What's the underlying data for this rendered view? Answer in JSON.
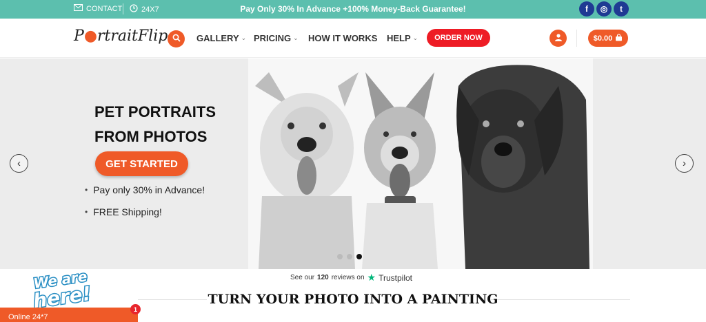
{
  "topbar": {
    "contact_label": "CONTACT",
    "hours_label": "24X7",
    "promo": "Pay Only 30% In Advance +100% Money-Back Guarantee!",
    "social": [
      {
        "icon": "facebook-icon",
        "glyph": "f"
      },
      {
        "icon": "instagram-icon",
        "glyph": "◎"
      },
      {
        "icon": "twitter-icon",
        "glyph": "t"
      }
    ],
    "color": "#5cbfae"
  },
  "header": {
    "logo_text_a": "P",
    "logo_text_b": "rtrait",
    "logo_text_c": "Flip",
    "nav": [
      {
        "label": "GALLERY",
        "dropdown": true
      },
      {
        "label": "PRICING",
        "dropdown": true
      },
      {
        "label": "HOW IT WORKS",
        "dropdown": false
      },
      {
        "label": "HELP",
        "dropdown": true
      }
    ],
    "order_label": "ORDER NOW",
    "cart_label": "$0.00",
    "accent": "#ef5a28"
  },
  "hero": {
    "title_line1": "PET PORTRAITS",
    "title_line2": "FROM PHOTOS",
    "cta_label": "GET STARTED",
    "bullets": [
      "Pay only 30% in Advance!",
      "FREE Shipping!"
    ],
    "prev_glyph": "‹",
    "next_glyph": "›",
    "slides_count": 3,
    "active_slide": 3
  },
  "reviews": {
    "prefix": "See our",
    "count": "120",
    "suffix": "reviews on",
    "brand": "Trustpilot"
  },
  "section": {
    "title": "TURN YOUR PHOTO INTO A PAINTING"
  },
  "chat": {
    "badge_text": "We are here!",
    "status": "Online 24*7",
    "unread": "1"
  }
}
